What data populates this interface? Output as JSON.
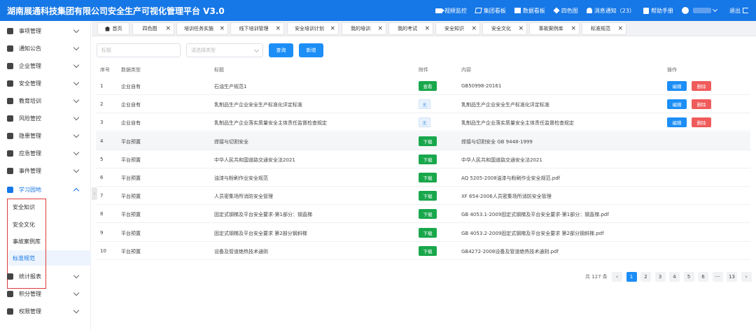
{
  "header": {
    "title": "湖南展通科技集团有限公司安全生产可视化管理平台  V3.0",
    "nav": [
      {
        "label": "视频监控",
        "icon": "video-icon"
      },
      {
        "label": "集团看板",
        "icon": "map-icon"
      },
      {
        "label": "数据看板",
        "icon": "dashboard-icon"
      },
      {
        "label": "四色图",
        "icon": "cube-icon"
      },
      {
        "label": "消息通知（23）",
        "icon": "bell-icon"
      },
      {
        "label": "帮助手册",
        "icon": "book-icon"
      }
    ],
    "logout": "退出"
  },
  "sidebar": {
    "items": [
      {
        "label": "事项管理"
      },
      {
        "label": "通知公告"
      },
      {
        "label": "企业管理"
      },
      {
        "label": "安全管理"
      },
      {
        "label": "教育培训"
      },
      {
        "label": "风险管控"
      },
      {
        "label": "隐患管理"
      },
      {
        "label": "应急管理"
      },
      {
        "label": "事件管理"
      },
      {
        "label": "学习园地"
      },
      {
        "label": "统计报表"
      },
      {
        "label": "积分管理"
      },
      {
        "label": "权限管理"
      }
    ],
    "sub_items": [
      {
        "label": "安全知识"
      },
      {
        "label": "安全文化"
      },
      {
        "label": "事故案例库"
      },
      {
        "label": "标准规范"
      }
    ],
    "collapse_glyph": "‹"
  },
  "tabs": [
    {
      "label": "首页"
    },
    {
      "label": "四色图"
    },
    {
      "label": "培训任务实施"
    },
    {
      "label": "线下培训管理"
    },
    {
      "label": "安全培训计划"
    },
    {
      "label": "我的培训"
    },
    {
      "label": "我的考试"
    },
    {
      "label": "安全知识"
    },
    {
      "label": "安全文化"
    },
    {
      "label": "事故案例库"
    },
    {
      "label": "标准规范"
    }
  ],
  "filters": {
    "title_placeholder": "标题",
    "type_placeholder": "请选择类型",
    "search_label": "查询",
    "add_label": "新增"
  },
  "table": {
    "columns": [
      "序号",
      "数据类型",
      "标题",
      "附件",
      "内容",
      "操作"
    ],
    "edit_label": "编辑",
    "delete_label": "删除",
    "rows": [
      {
        "no": "1",
        "type": "企业自有",
        "title": "石油生产规范1",
        "attachment": "查看",
        "content": "GB50998-20161"
      },
      {
        "no": "2",
        "type": "企业自有",
        "title": "乳制品生产企业安全生产标准化评定标准",
        "attachment": "无",
        "content": "乳制品生产企业安全生产标准化评定标准"
      },
      {
        "no": "3",
        "type": "企业自有",
        "title": "乳制品生产企业落实质量安全主体责任监督检查规定",
        "attachment": "无",
        "content": "乳制品生产企业落实质量安全主体责任监督检查规定"
      },
      {
        "no": "4",
        "type": "平台预置",
        "title": "焊接与切割安全",
        "attachment": "下载",
        "content": "焊接与切割安全 GB 9448-1999"
      },
      {
        "no": "5",
        "type": "平台预置",
        "title": "中华人民共和国道路交通安全法2021",
        "attachment": "下载",
        "content": "中华人民共和国道路交通安全法2021"
      },
      {
        "no": "6",
        "type": "平台预置",
        "title": "油漆与粉刷作业安全规范",
        "attachment": "下载",
        "content": "AQ 5205-2008油漆与粉刷作业安全规范.pdf"
      },
      {
        "no": "7",
        "type": "平台预置",
        "title": "人员密集场所消防安全管理",
        "attachment": "下载",
        "content": "XF 654-2006人员密集场所消防安全管理"
      },
      {
        "no": "8",
        "type": "平台预置",
        "title": "固定式钢梯及平台安全要求-第1部分：钢直梯",
        "attachment": "下载",
        "content": "GB 4053.1-2009固定式钢梯及平台安全要求-第1部分：钢直梯.pdf"
      },
      {
        "no": "9",
        "type": "平台预置",
        "title": "固定式钢梯及平台安全要求 第2部分钢斜梯",
        "attachment": "下载",
        "content": "GB 4053.2-2009固定式钢梯及平台安全要求 第2部分钢斜梯.pdf"
      },
      {
        "no": "10",
        "type": "平台预置",
        "title": "设备及管道绝热技术通则",
        "attachment": "下载",
        "content": "GB4272-2008设备及管道绝热技术通则.pdf"
      }
    ]
  },
  "pagination": {
    "total": "共 127 条",
    "prev": "‹",
    "next": "›",
    "pages": [
      "1",
      "2",
      "3",
      "4",
      "5",
      "6",
      "···",
      "13"
    ],
    "current": "1"
  },
  "colors": {
    "primary": "#1677e6",
    "success": "#19a74c",
    "danger": "#f05b5b",
    "highlight_border": "#e03b3b"
  }
}
